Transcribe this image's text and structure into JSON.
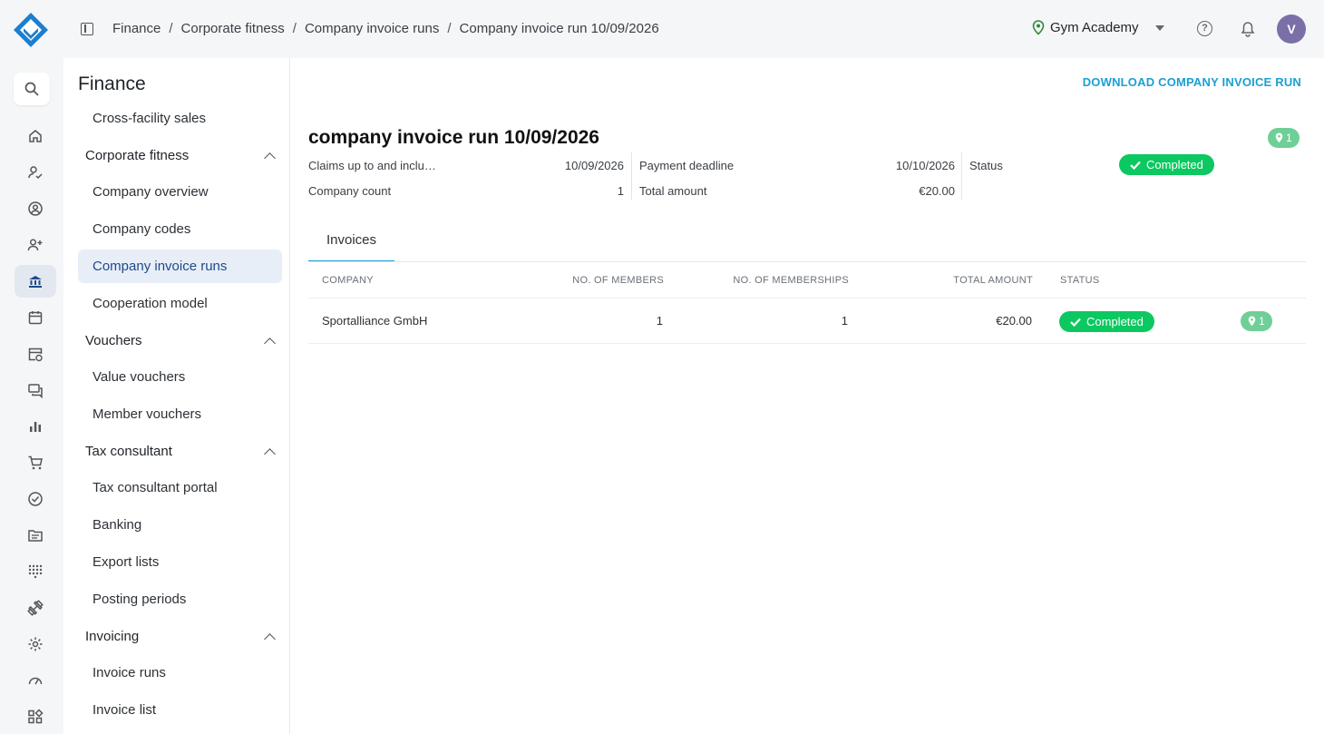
{
  "breadcrumbs": [
    "Finance",
    "Corporate fitness",
    "Company invoice runs",
    "Company invoice run 10/09/2026"
  ],
  "header": {
    "tenant": "Gym Academy",
    "avatar_initial": "V"
  },
  "rail": [
    "search-icon",
    "home-icon",
    "user-check-icon",
    "user-circle-icon",
    "user-plus-icon",
    "bank-icon",
    "calendar-icon",
    "calendar-clock-icon",
    "chat-icon",
    "bar-chart-icon",
    "cart-icon",
    "check-circle-icon",
    "folder-icon",
    "grid-dots-icon",
    "dumbbell-icon",
    "gear-icon",
    "gauge-icon",
    "widgets-icon"
  ],
  "sidebar": {
    "title": "Finance",
    "items": {
      "cross_facility": "Cross-facility sales",
      "corporate_fitness": "Corporate fitness",
      "company_overview": "Company overview",
      "company_codes": "Company codes",
      "company_invoice_runs": "Company invoice runs",
      "cooperation_model": "Cooperation model",
      "vouchers": "Vouchers",
      "value_vouchers": "Value vouchers",
      "member_vouchers": "Member vouchers",
      "tax_consultant": "Tax consultant",
      "tax_consultant_portal": "Tax consultant portal",
      "banking": "Banking",
      "export_lists": "Export lists",
      "posting_periods": "Posting periods",
      "invoicing": "Invoicing",
      "invoice_runs": "Invoice runs",
      "invoice_list": "Invoice list"
    }
  },
  "main": {
    "download_label": "DOWNLOAD COMPANY INVOICE RUN",
    "title": "company invoice run 10/09/2026",
    "location_count": "1",
    "summary": {
      "claims_label": "Claims up to and inclu…",
      "claims_value": "10/09/2026",
      "company_count_label": "Company count",
      "company_count_value": "1",
      "payment_deadline_label": "Payment deadline",
      "payment_deadline_value": "10/10/2026",
      "total_amount_label": "Total amount",
      "total_amount_value": "€20.00",
      "status_label": "Status",
      "status_value": "Completed"
    },
    "tab_invoices": "Invoices",
    "table": {
      "headers": {
        "company": "COMPANY",
        "members": "NO. OF MEMBERS",
        "memberships": "NO. OF MEMBERSHIPS",
        "total": "TOTAL AMOUNT",
        "status": "STATUS"
      },
      "rows": [
        {
          "company": "Sportalliance GmbH",
          "members": "1",
          "memberships": "1",
          "total": "€20.00",
          "status": "Completed",
          "locations": "1"
        }
      ]
    }
  },
  "colors": {
    "accent": "#1b9fd4",
    "success": "#0cc860",
    "location_badge": "#6fcf97",
    "active_nav_bg": "#e8eef8"
  }
}
